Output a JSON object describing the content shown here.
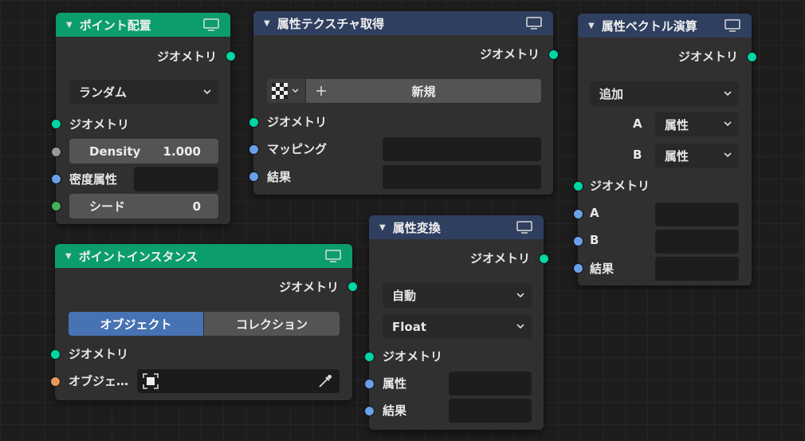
{
  "nodes": {
    "point_distribute": {
      "title": "ポイント配置",
      "output_geometry": "ジオメトリ",
      "mode": "ランダム",
      "input_geometry": "ジオメトリ",
      "density_label": "Density",
      "density_value": "1.000",
      "density_attr_label": "密度属性",
      "seed_label": "シード",
      "seed_value": "0"
    },
    "attribute_sample_texture": {
      "title": "属性テクスチャ取得",
      "output_geometry": "ジオメトリ",
      "new_label": "新規",
      "input_geometry": "ジオメトリ",
      "mapping_label": "マッピング",
      "result_label": "結果"
    },
    "attribute_vector_math": {
      "title": "属性ベクトル演算",
      "output_geometry": "ジオメトリ",
      "operation": "追加",
      "a_label": "A",
      "a_type": "属性",
      "b_label": "B",
      "b_type": "属性",
      "input_geometry": "ジオメトリ",
      "a_input": "A",
      "b_input": "B",
      "result_label": "結果"
    },
    "point_instance": {
      "title": "ポイントインスタンス",
      "output_geometry": "ジオメトリ",
      "tab_object": "オブジェクト",
      "tab_collection": "コレクション",
      "input_geometry": "ジオメトリ",
      "object_label": "オブジェ…"
    },
    "attribute_convert": {
      "title": "属性変換",
      "output_geometry": "ジオメトリ",
      "domain": "自動",
      "data_type": "Float",
      "input_geometry": "ジオメトリ",
      "attribute_label": "属性",
      "result_label": "結果"
    }
  },
  "colors": {
    "geometry_socket": "#00d6a3",
    "float_socket": "#9a9a9a",
    "string_socket": "#6aa0ea",
    "int_socket": "#46b05a",
    "object_socket": "#e8965a",
    "header_geometry": "#0b9d6e",
    "header_attribute": "#2f3f5f",
    "active_tab": "#4772b3"
  },
  "icons": [
    "collapse-arrow-icon",
    "preview-monitor-icon",
    "chevron-down-icon",
    "checker-texture-icon",
    "plus-icon",
    "object-target-icon",
    "eyedropper-icon"
  ]
}
